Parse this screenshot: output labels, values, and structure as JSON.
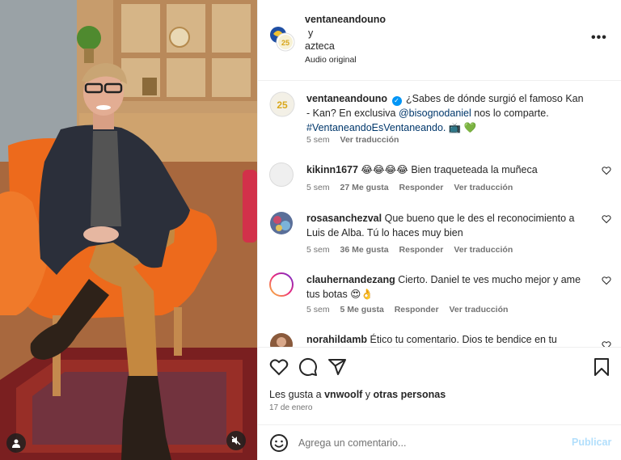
{
  "header": {
    "username": "ventaneandouno",
    "connector": "y",
    "collaborator": "azteca",
    "audio": "Audio original",
    "more_icon": "more-horizontal-icon"
  },
  "caption": {
    "username": "ventaneandouno",
    "text_before": "¿Sabes de dónde surgió el famoso Kan - Kan? En exclusiva ",
    "mention": "@bisognodaniel",
    "text_after": " nos lo comparte.",
    "hashtag": "#VentaneandoEsVentaneando.",
    "emojis": "📺 💚",
    "time": "5 sem",
    "translate": "Ver traducción"
  },
  "comments": [
    {
      "username": "kikinn1677",
      "text": "😂😂😂😂 Bien traqueteada la muñeca",
      "time": "5 sem",
      "likes": "27 Me gusta",
      "reply": "Responder",
      "translate": "Ver traducción"
    },
    {
      "username": "rosasanchezval",
      "text": "Que bueno que le des el reconocimiento a Luis de Alba. Tú lo haces muy bien",
      "time": "5 sem",
      "likes": "36 Me gusta",
      "reply": "Responder",
      "translate": "Ver traducción"
    },
    {
      "username": "clauhernandezang",
      "text": "Cierto. Daniel te ves mucho mejor y ame tus botas 😍👌",
      "time": "5 sem",
      "likes": "5 Me gusta",
      "reply": "Responder",
      "translate": "Ver traducción"
    },
    {
      "username": "norahildamb",
      "text": "Ético tu comentario. Dios te bendice en tu",
      "time": "",
      "likes": "",
      "reply": "",
      "translate": ""
    }
  ],
  "actions": {
    "icons": [
      "heart-icon",
      "comment-icon",
      "share-icon",
      "bookmark-icon"
    ],
    "likes_prefix": "Les gusta a ",
    "likes_user": "vnwoolf",
    "likes_middle": " y ",
    "likes_others": "otras personas",
    "date": "17 de enero"
  },
  "add_comment": {
    "placeholder": "Agrega un comentario...",
    "publish": "Publicar"
  },
  "colors": {
    "link": "#00376b",
    "verified": "#0095f6",
    "publish_disabled": "#b2dffc",
    "muted": "#737373"
  }
}
